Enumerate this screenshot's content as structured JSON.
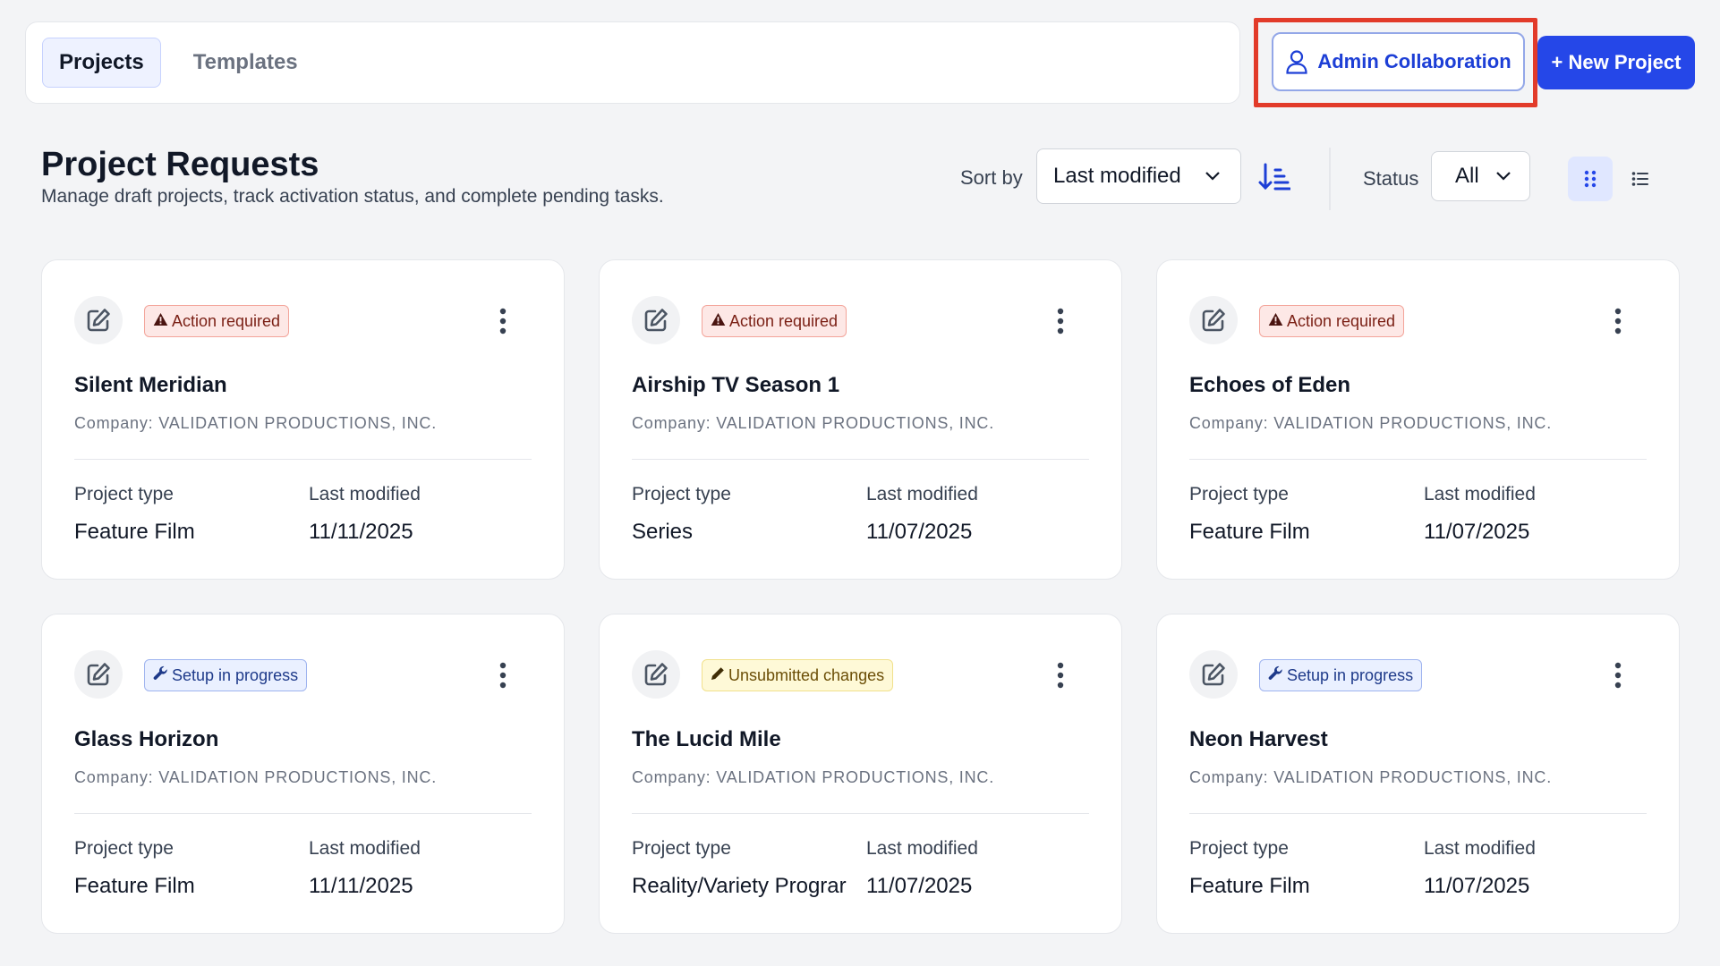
{
  "tabs": {
    "projects": "Projects",
    "templates": "Templates"
  },
  "actions": {
    "admin_collaboration": "Admin Collaboration",
    "new_project": "+ New Project"
  },
  "header": {
    "title": "Project Requests",
    "subtitle": "Manage draft projects, track activation status, and complete pending tasks."
  },
  "controls": {
    "sort_label": "Sort by",
    "sort_value": "Last modified",
    "status_label": "Status",
    "status_value": "All"
  },
  "labels": {
    "project_type": "Project type",
    "last_modified": "Last modified"
  },
  "colors": {
    "primary": "#2547e8",
    "highlight": "#e23b2a",
    "badge_red": "#fde8e6",
    "badge_blue": "#eaf0ff",
    "badge_yellow": "#fef9d7"
  },
  "cards": [
    {
      "title": "Silent Meridian",
      "company": "Company: VALIDATION PRODUCTIONS, INC.",
      "status": "Action required",
      "status_icon": "warning-icon",
      "project_type": "Feature Film",
      "last_modified": "11/11/2025"
    },
    {
      "title": "Airship TV Season 1",
      "company": "Company: VALIDATION PRODUCTIONS, INC.",
      "status": "Action required",
      "status_icon": "warning-icon",
      "project_type": "Series",
      "last_modified": "11/07/2025"
    },
    {
      "title": "Echoes of Eden",
      "company": "Company: VALIDATION PRODUCTIONS, INC.",
      "status": "Action required",
      "status_icon": "warning-icon",
      "project_type": "Feature Film",
      "last_modified": "11/07/2025"
    },
    {
      "title": "Glass Horizon",
      "company": "Company: VALIDATION PRODUCTIONS, INC.",
      "status": "Setup in progress",
      "status_icon": "wrench-icon",
      "project_type": "Feature Film",
      "last_modified": "11/11/2025"
    },
    {
      "title": "The Lucid Mile",
      "company": "Company: VALIDATION PRODUCTIONS, INC.",
      "status": "Unsubmitted changes",
      "status_icon": "pencil-icon",
      "project_type": "Reality/Variety Prograr",
      "last_modified": "11/07/2025"
    },
    {
      "title": "Neon Harvest",
      "company": "Company: VALIDATION PRODUCTIONS, INC.",
      "status": "Setup in progress",
      "status_icon": "wrench-icon",
      "project_type": "Feature Film",
      "last_modified": "11/07/2025"
    }
  ]
}
